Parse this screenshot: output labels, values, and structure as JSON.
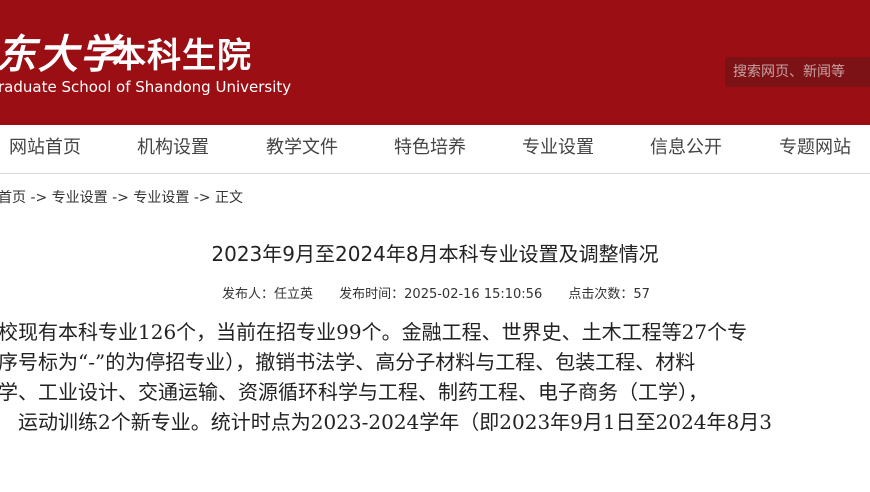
{
  "header": {
    "logo_calligraphy": "东大学",
    "logo_title": "本科生院",
    "logo_english": "raduate School of Shandong University",
    "search_placeholder": "搜索网页、新闻等"
  },
  "nav": [
    {
      "label": "网站首页"
    },
    {
      "label": "机构设置"
    },
    {
      "label": "教学文件"
    },
    {
      "label": "特色培养"
    },
    {
      "label": "专业设置"
    },
    {
      "label": "信息公开"
    },
    {
      "label": "专题网站"
    }
  ],
  "breadcrumb": "首页 -> 专业设置 -> 专业设置 -> 正文",
  "article": {
    "title": "2023年9月至2024年8月本科专业设置及调整情况",
    "author": "发布人：任立英",
    "time": "发布时间：2025-02-16 15:10:56",
    "clicks": "点击次数：57",
    "lines": [
      "校现有本科专业126个，当前在招专业99个。金融工程、世界史、土木工程等27个专",
      "序号标为“-”的为停招专业），撤销书法学、高分子材料与工程、包装工程、材料",
      "学、工业设计、交通运输、资源循环科学与工程、制药工程、电子商务（工学），",
      "运动训练2个新专业。统计时点为2023-2024学年（即2023年9月1日至2024年8月3"
    ]
  }
}
